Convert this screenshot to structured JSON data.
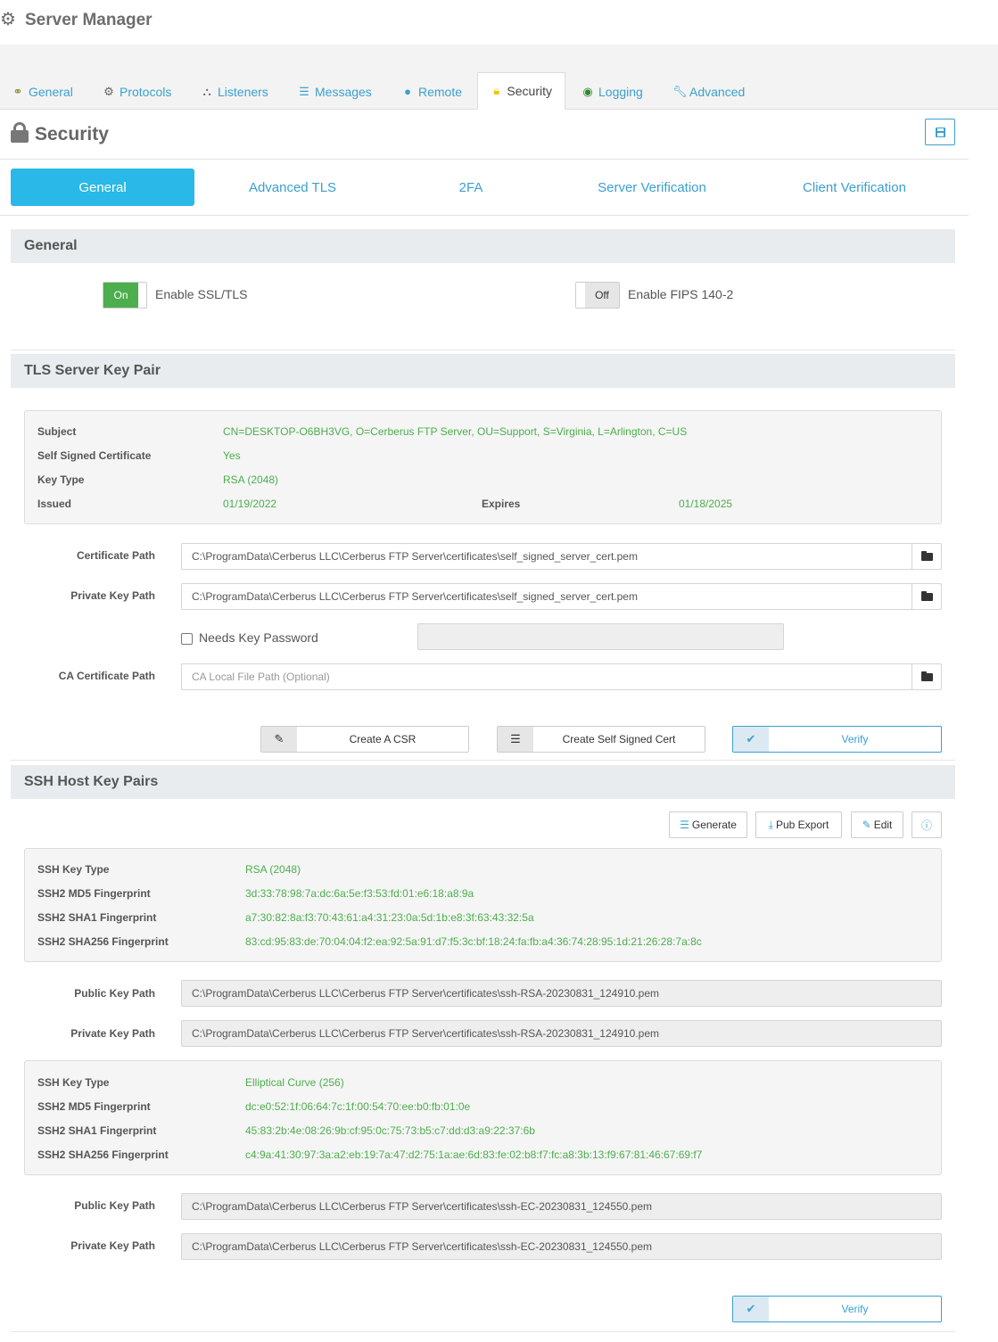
{
  "window": {
    "title": "Server Manager"
  },
  "tabs": [
    {
      "label": "General",
      "icon": "connections-icon"
    },
    {
      "label": "Protocols",
      "icon": "gear-icon"
    },
    {
      "label": "Listeners",
      "icon": "sitemap-icon"
    },
    {
      "label": "Messages",
      "icon": "list-icon"
    },
    {
      "label": "Remote",
      "icon": "globe-icon"
    },
    {
      "label": "Security",
      "icon": "lock-icon",
      "active": true
    },
    {
      "label": "Logging",
      "icon": "eye-icon"
    },
    {
      "label": "Advanced",
      "icon": "wrench-icon"
    }
  ],
  "page": {
    "title": "Security"
  },
  "subtabs": [
    "General",
    "Advanced TLS",
    "2FA",
    "Server Verification",
    "Client Verification"
  ],
  "general": {
    "heading": "General",
    "ssl_toggle": "On",
    "ssl_label": "Enable SSL/TLS",
    "fips_toggle": "Off",
    "fips_label": "Enable FIPS 140-2"
  },
  "tls": {
    "heading": "TLS Server Key Pair",
    "subject_label": "Subject",
    "subject": "CN=DESKTOP-O6BH3VG, O=Cerberus FTP Server, OU=Support, S=Virginia, L=Arlington, C=US",
    "self_signed_label": "Self Signed Certificate",
    "self_signed": "Yes",
    "key_type_label": "Key Type",
    "key_type": "RSA (2048)",
    "issued_label": "Issued",
    "issued": "01/19/2022",
    "expires_label": "Expires",
    "expires": "01/18/2025",
    "cert_path_label": "Certificate Path",
    "cert_path": "C:\\ProgramData\\Cerberus LLC\\Cerberus FTP Server\\certificates\\self_signed_server_cert.pem",
    "key_path_label": "Private Key Path",
    "key_path": "C:\\ProgramData\\Cerberus LLC\\Cerberus FTP Server\\certificates\\self_signed_server_cert.pem",
    "needs_password_label": "Needs Key Password",
    "needs_password": false,
    "ca_path_label": "CA Certificate Path",
    "ca_path_placeholder": "CA Local File Path (Optional)",
    "create_csr": "Create A CSR",
    "create_self_signed": "Create Self Signed Cert",
    "verify": "Verify"
  },
  "ssh": {
    "heading": "SSH Host Key Pairs",
    "buttons": {
      "generate": "Generate",
      "pub_export": "Pub Export",
      "edit": "Edit"
    },
    "labels": {
      "key_type": "SSH Key Type",
      "md5": "SSH2 MD5 Fingerprint",
      "sha1": "SSH2 SHA1 Fingerprint",
      "sha256": "SSH2 SHA256 Fingerprint",
      "public_path": "Public Key Path",
      "private_path": "Private Key Path"
    },
    "keys": [
      {
        "key_type": "RSA (2048)",
        "md5": "3d:33:78:98:7a:dc:6a:5e:f3:53:fd:01:e6:18:a8:9a",
        "sha1": "a7:30:82:8a:f3:70:43:61:a4:31:23:0a:5d:1b:e8:3f:63:43:32:5a",
        "sha256": "83:cd:95:83:de:70:04:04:f2:ea:92:5a:91:d7:f5:3c:bf:18:24:fa:fb:a4:36:74:28:95:1d:21:26:28:7a:8c",
        "public_path": "C:\\ProgramData\\Cerberus LLC\\Cerberus FTP Server\\certificates\\ssh-RSA-20230831_124910.pem",
        "private_path": "C:\\ProgramData\\Cerberus LLC\\Cerberus FTP Server\\certificates\\ssh-RSA-20230831_124910.pem"
      },
      {
        "key_type": "Elliptical Curve (256)",
        "md5": "dc:e0:52:1f:06:64:7c:1f:00:54:70:ee:b0:fb:01:0e",
        "sha1": "45:83:2b:4e:08:26:9b:cf:95:0c:75:73:b5:c7:dd:d3:a9:22:37:6b",
        "sha256": "c4:9a:41:30:97:3a:a2:eb:19:7a:47:d2:75:1a:ae:6d:83:fe:02:b8:f7:fc:a8:3b:13:f9:67:81:46:67:69:f7",
        "public_path": "C:\\ProgramData\\Cerberus LLC\\Cerberus FTP Server\\certificates\\ssh-EC-20230831_124550.pem",
        "private_path": "C:\\ProgramData\\Cerberus LLC\\Cerberus FTP Server\\certificates\\ssh-EC-20230831_124550.pem"
      }
    ],
    "verify": "Verify"
  },
  "colors": {
    "accent": "#3aa0cf",
    "active_subtab": "#29b8e8",
    "value_green": "#4cae4c",
    "section_bg": "#e8ecee",
    "lock_yellow": "#f5c400"
  }
}
